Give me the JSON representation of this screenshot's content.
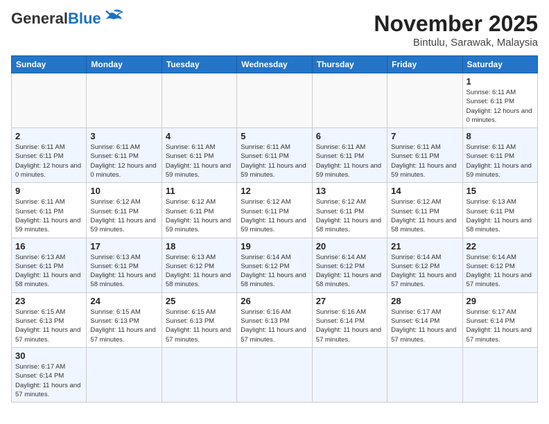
{
  "header": {
    "logo_text_general": "General",
    "logo_text_blue": "Blue",
    "month": "November 2025",
    "location": "Bintulu, Sarawak, Malaysia"
  },
  "weekdays": [
    "Sunday",
    "Monday",
    "Tuesday",
    "Wednesday",
    "Thursday",
    "Friday",
    "Saturday"
  ],
  "weeks": [
    [
      {
        "day": null
      },
      {
        "day": null
      },
      {
        "day": null
      },
      {
        "day": null
      },
      {
        "day": null
      },
      {
        "day": null
      },
      {
        "day": 1,
        "sunrise": "6:11 AM",
        "sunset": "6:11 PM",
        "daylight": "12 hours and 0 minutes."
      }
    ],
    [
      {
        "day": 2,
        "sunrise": "6:11 AM",
        "sunset": "6:11 PM",
        "daylight": "12 hours and 0 minutes."
      },
      {
        "day": 3,
        "sunrise": "6:11 AM",
        "sunset": "6:11 PM",
        "daylight": "12 hours and 0 minutes."
      },
      {
        "day": 4,
        "sunrise": "6:11 AM",
        "sunset": "6:11 PM",
        "daylight": "11 hours and 59 minutes."
      },
      {
        "day": 5,
        "sunrise": "6:11 AM",
        "sunset": "6:11 PM",
        "daylight": "11 hours and 59 minutes."
      },
      {
        "day": 6,
        "sunrise": "6:11 AM",
        "sunset": "6:11 PM",
        "daylight": "11 hours and 59 minutes."
      },
      {
        "day": 7,
        "sunrise": "6:11 AM",
        "sunset": "6:11 PM",
        "daylight": "11 hours and 59 minutes."
      },
      {
        "day": 8,
        "sunrise": "6:11 AM",
        "sunset": "6:11 PM",
        "daylight": "11 hours and 59 minutes."
      }
    ],
    [
      {
        "day": 9,
        "sunrise": "6:11 AM",
        "sunset": "6:11 PM",
        "daylight": "11 hours and 59 minutes."
      },
      {
        "day": 10,
        "sunrise": "6:12 AM",
        "sunset": "6:11 PM",
        "daylight": "11 hours and 59 minutes."
      },
      {
        "day": 11,
        "sunrise": "6:12 AM",
        "sunset": "6:11 PM",
        "daylight": "11 hours and 59 minutes."
      },
      {
        "day": 12,
        "sunrise": "6:12 AM",
        "sunset": "6:11 PM",
        "daylight": "11 hours and 59 minutes."
      },
      {
        "day": 13,
        "sunrise": "6:12 AM",
        "sunset": "6:11 PM",
        "daylight": "11 hours and 58 minutes."
      },
      {
        "day": 14,
        "sunrise": "6:12 AM",
        "sunset": "6:11 PM",
        "daylight": "11 hours and 58 minutes."
      },
      {
        "day": 15,
        "sunrise": "6:13 AM",
        "sunset": "6:11 PM",
        "daylight": "11 hours and 58 minutes."
      }
    ],
    [
      {
        "day": 16,
        "sunrise": "6:13 AM",
        "sunset": "6:11 PM",
        "daylight": "11 hours and 58 minutes."
      },
      {
        "day": 17,
        "sunrise": "6:13 AM",
        "sunset": "6:11 PM",
        "daylight": "11 hours and 58 minutes."
      },
      {
        "day": 18,
        "sunrise": "6:13 AM",
        "sunset": "6:12 PM",
        "daylight": "11 hours and 58 minutes."
      },
      {
        "day": 19,
        "sunrise": "6:14 AM",
        "sunset": "6:12 PM",
        "daylight": "11 hours and 58 minutes."
      },
      {
        "day": 20,
        "sunrise": "6:14 AM",
        "sunset": "6:12 PM",
        "daylight": "11 hours and 58 minutes."
      },
      {
        "day": 21,
        "sunrise": "6:14 AM",
        "sunset": "6:12 PM",
        "daylight": "11 hours and 57 minutes."
      },
      {
        "day": 22,
        "sunrise": "6:14 AM",
        "sunset": "6:12 PM",
        "daylight": "11 hours and 57 minutes."
      }
    ],
    [
      {
        "day": 23,
        "sunrise": "6:15 AM",
        "sunset": "6:13 PM",
        "daylight": "11 hours and 57 minutes."
      },
      {
        "day": 24,
        "sunrise": "6:15 AM",
        "sunset": "6:13 PM",
        "daylight": "11 hours and 57 minutes."
      },
      {
        "day": 25,
        "sunrise": "6:15 AM",
        "sunset": "6:13 PM",
        "daylight": "11 hours and 57 minutes."
      },
      {
        "day": 26,
        "sunrise": "6:16 AM",
        "sunset": "6:13 PM",
        "daylight": "11 hours and 57 minutes."
      },
      {
        "day": 27,
        "sunrise": "6:16 AM",
        "sunset": "6:14 PM",
        "daylight": "11 hours and 57 minutes."
      },
      {
        "day": 28,
        "sunrise": "6:17 AM",
        "sunset": "6:14 PM",
        "daylight": "11 hours and 57 minutes."
      },
      {
        "day": 29,
        "sunrise": "6:17 AM",
        "sunset": "6:14 PM",
        "daylight": "11 hours and 57 minutes."
      }
    ],
    [
      {
        "day": 30,
        "sunrise": "6:17 AM",
        "sunset": "6:14 PM",
        "daylight": "11 hours and 57 minutes."
      },
      {
        "day": null
      },
      {
        "day": null
      },
      {
        "day": null
      },
      {
        "day": null
      },
      {
        "day": null
      },
      {
        "day": null
      }
    ]
  ]
}
